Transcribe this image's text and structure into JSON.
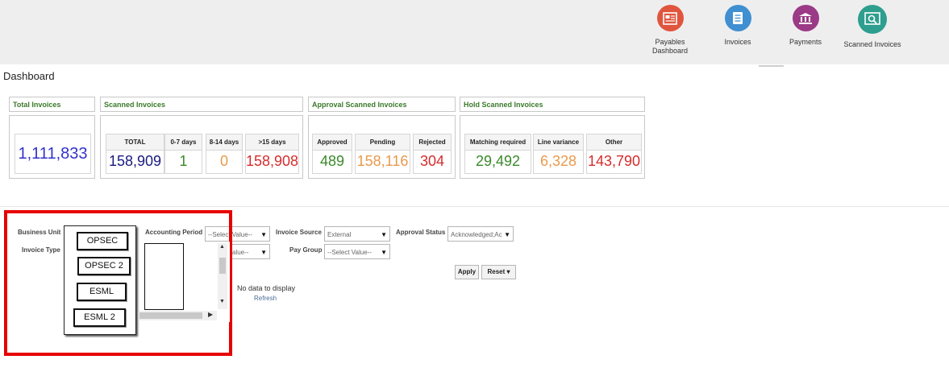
{
  "nav": {
    "items": [
      {
        "label": "Payables Dashboard",
        "icon": "payables-dashboard-icon",
        "color": "#e0553d"
      },
      {
        "label": "Invoices",
        "icon": "invoices-icon",
        "color": "#3f8fd1"
      },
      {
        "label": "Payments",
        "icon": "payments-icon",
        "color": "#9b3a86"
      },
      {
        "label": "Scanned Invoices",
        "icon": "scanned-invoices-icon",
        "color": "#2e9e8e"
      }
    ]
  },
  "page": {
    "title": "Dashboard"
  },
  "kpi": {
    "total": {
      "header": "Total Invoices",
      "value": "1,111,833",
      "color": "#3333cc"
    },
    "scanned": {
      "header": "Scanned Invoices",
      "tiles": [
        {
          "label": "TOTAL",
          "value": "158,909",
          "color": "#1a1a80"
        },
        {
          "label": "0-7 days",
          "value": "1",
          "color": "#3a8a2a"
        },
        {
          "label": "8-14 days",
          "value": "0",
          "color": "#e89a4c"
        },
        {
          "label": ">15 days",
          "value": "158,908",
          "color": "#d62c2c"
        }
      ]
    },
    "approval": {
      "header": "Approval Scanned Invoices",
      "tiles": [
        {
          "label": "Approved",
          "value": "489",
          "color": "#3a8a2a"
        },
        {
          "label": "Pending",
          "value": "158,116",
          "color": "#e89a4c"
        },
        {
          "label": "Rejected",
          "value": "304",
          "color": "#d62c2c"
        }
      ]
    },
    "hold": {
      "header": "Hold Scanned Invoices",
      "tiles": [
        {
          "label": "Matching required",
          "value": "29,492",
          "color": "#3a8a2a"
        },
        {
          "label": "Line variance",
          "value": "6,328",
          "color": "#e89a4c"
        },
        {
          "label": "Other",
          "value": "143,790",
          "color": "#d62c2c"
        }
      ]
    }
  },
  "filters": {
    "business_unit_label": "Business Unit",
    "invoice_type_label": "Invoice Type",
    "accounting_period_label": "Accounting Period",
    "accounting_period_value": "--Select Value--",
    "second_select_value": "alue--",
    "invoice_source_label": "Invoice Source",
    "invoice_source_value": "External",
    "pay_group_label": "Pay Group",
    "pay_group_value": "--Select Value--",
    "approval_status_label": "Approval Status",
    "approval_status_value": "Acknowledged;Ac",
    "apply_label": "Apply",
    "reset_label": "Reset ▾",
    "dropdown_glyph": "▼"
  },
  "business_unit_options": [
    "OPSEC",
    "OPSEC 2",
    "ESML",
    "ESML 2"
  ],
  "results": {
    "no_data": "No data to display",
    "refresh": "Refresh"
  },
  "highlight_color": "#e60000"
}
